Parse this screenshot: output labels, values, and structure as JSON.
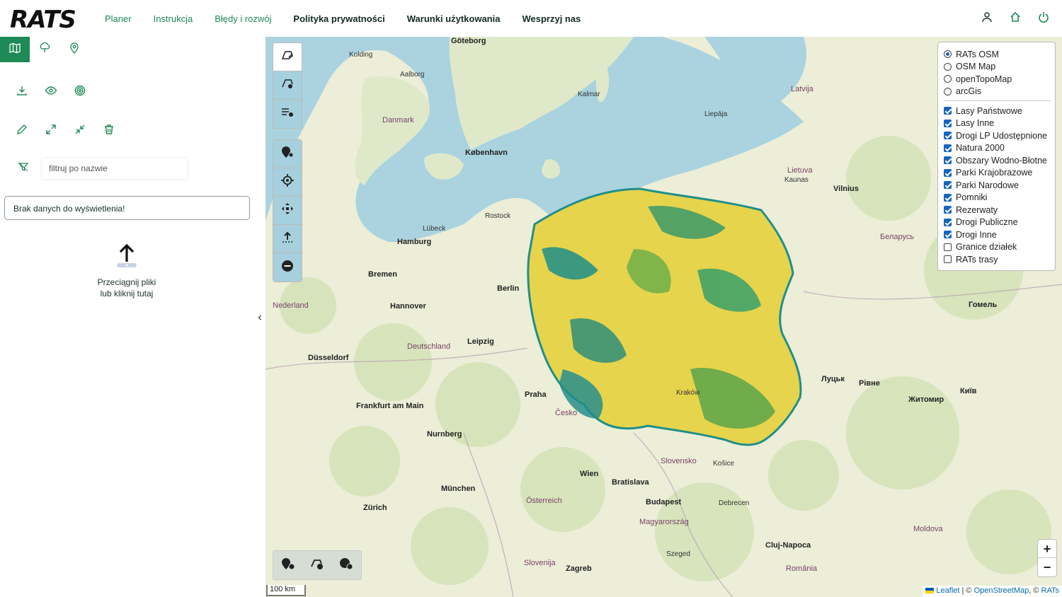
{
  "app": {
    "logo": "RATS"
  },
  "nav": {
    "items": [
      {
        "label": "Planer",
        "style": "green"
      },
      {
        "label": "Instrukcja",
        "style": "green"
      },
      {
        "label": "Błędy i rozwój",
        "style": "green"
      },
      {
        "label": "Polityka prywatności",
        "style": "dark"
      },
      {
        "label": "Warunki użytkowania",
        "style": "dark"
      },
      {
        "label": "Wesprzyj nas",
        "style": "dark"
      }
    ]
  },
  "colors": {
    "accent": "#1e8a55",
    "checkbox": "#1565c0",
    "sea": "#aad3df"
  },
  "sidebar": {
    "filter_placeholder": "filtruj po nazwie",
    "empty_message": "Brak danych do wyświetlenia!",
    "upload_line1": "Przeciągnij pliki",
    "upload_line2": "lub kliknij tutaj"
  },
  "map": {
    "base_layers": [
      {
        "label": "RATs OSM",
        "checked": true
      },
      {
        "label": "OSM Map",
        "checked": false
      },
      {
        "label": "openTopoMap",
        "checked": false
      },
      {
        "label": "arcGis",
        "checked": false
      }
    ],
    "overlays": [
      {
        "label": "Lasy Państwowe",
        "checked": true
      },
      {
        "label": "Lasy Inne",
        "checked": true
      },
      {
        "label": "Drogi LP Udostępnione",
        "checked": true
      },
      {
        "label": "Natura 2000",
        "checked": true
      },
      {
        "label": "Obszary Wodno-Błotne",
        "checked": true
      },
      {
        "label": "Parki Krajobrazowe",
        "checked": true
      },
      {
        "label": "Parki Narodowe",
        "checked": true
      },
      {
        "label": "Pomniki",
        "checked": true
      },
      {
        "label": "Rezerwaty",
        "checked": true
      },
      {
        "label": "Drogi Publiczne",
        "checked": true
      },
      {
        "label": "Drogi Inne",
        "checked": true
      },
      {
        "label": "Granice działek",
        "checked": false
      },
      {
        "label": "RATs trasy",
        "checked": false
      }
    ],
    "scale": "100 km",
    "attribution": {
      "leaflet": "Leaflet",
      "sep1": " | © ",
      "osm": "OpenStreetMap",
      "sep2": ", © ",
      "rats": "RATs"
    },
    "zoom_in": "+",
    "zoom_out": "−",
    "collapse": "‹",
    "labels": [
      {
        "t": "Göteborg",
        "k": "b"
      },
      {
        "t": "Aalborg",
        "k": ""
      },
      {
        "t": "Danmark",
        "k": "c"
      },
      {
        "t": "København",
        "k": "b"
      },
      {
        "t": "Hamburg",
        "k": "b"
      },
      {
        "t": "Bremen",
        "k": "b"
      },
      {
        "t": "Berlin",
        "k": "b"
      },
      {
        "t": "Hannover",
        "k": "b"
      },
      {
        "t": "Deutschland",
        "k": "c"
      },
      {
        "t": "Leipzig",
        "k": "b"
      },
      {
        "t": "Praha",
        "k": "b"
      },
      {
        "t": "Česko",
        "k": "c"
      },
      {
        "t": "Wien",
        "k": "b"
      },
      {
        "t": "Bratislava",
        "k": "b"
      },
      {
        "t": "Budapest",
        "k": "b"
      },
      {
        "t": "Slovensko",
        "k": "c"
      },
      {
        "t": "Magyarország",
        "k": "c"
      },
      {
        "t": "Österreich",
        "k": "c"
      },
      {
        "t": "München",
        "k": "b"
      },
      {
        "t": "Zürich",
        "k": "b"
      },
      {
        "t": "Latvija",
        "k": "c"
      },
      {
        "t": "Lietuva",
        "k": "c"
      },
      {
        "t": "Vilnius",
        "k": "b"
      },
      {
        "t": "Kaunas",
        "k": ""
      },
      {
        "t": "Беларусь",
        "k": "c"
      },
      {
        "t": "Гомель",
        "k": "b"
      },
      {
        "t": "Київ",
        "k": "b"
      },
      {
        "t": "Житомир",
        "k": "b"
      },
      {
        "t": "Луцьк",
        "k": "b"
      },
      {
        "t": "Рівне",
        "k": "b"
      },
      {
        "t": "România",
        "k": "c"
      },
      {
        "t": "Cluj-Napoca",
        "k": "b"
      },
      {
        "t": "Debrecen",
        "k": ""
      },
      {
        "t": "Slovenija",
        "k": "c"
      },
      {
        "t": "Zagreb",
        "k": "b"
      },
      {
        "t": "Nederland",
        "k": "c"
      },
      {
        "t": "Düsseldorf",
        "k": "b"
      },
      {
        "t": "Frankfurt am Main",
        "k": "b"
      },
      {
        "t": "Nurnberg",
        "k": "b"
      },
      {
        "t": "Kolding",
        "k": ""
      },
      {
        "t": "Lübeck",
        "k": ""
      },
      {
        "t": "Rostock",
        "k": ""
      },
      {
        "t": "Kalmar",
        "k": ""
      },
      {
        "t": "Liepāja",
        "k": ""
      },
      {
        "t": "Moldova",
        "k": "c"
      },
      {
        "t": "Kraków",
        "k": ""
      },
      {
        "t": "Szeged",
        "k": ""
      },
      {
        "t": "Košice",
        "k": ""
      }
    ]
  }
}
